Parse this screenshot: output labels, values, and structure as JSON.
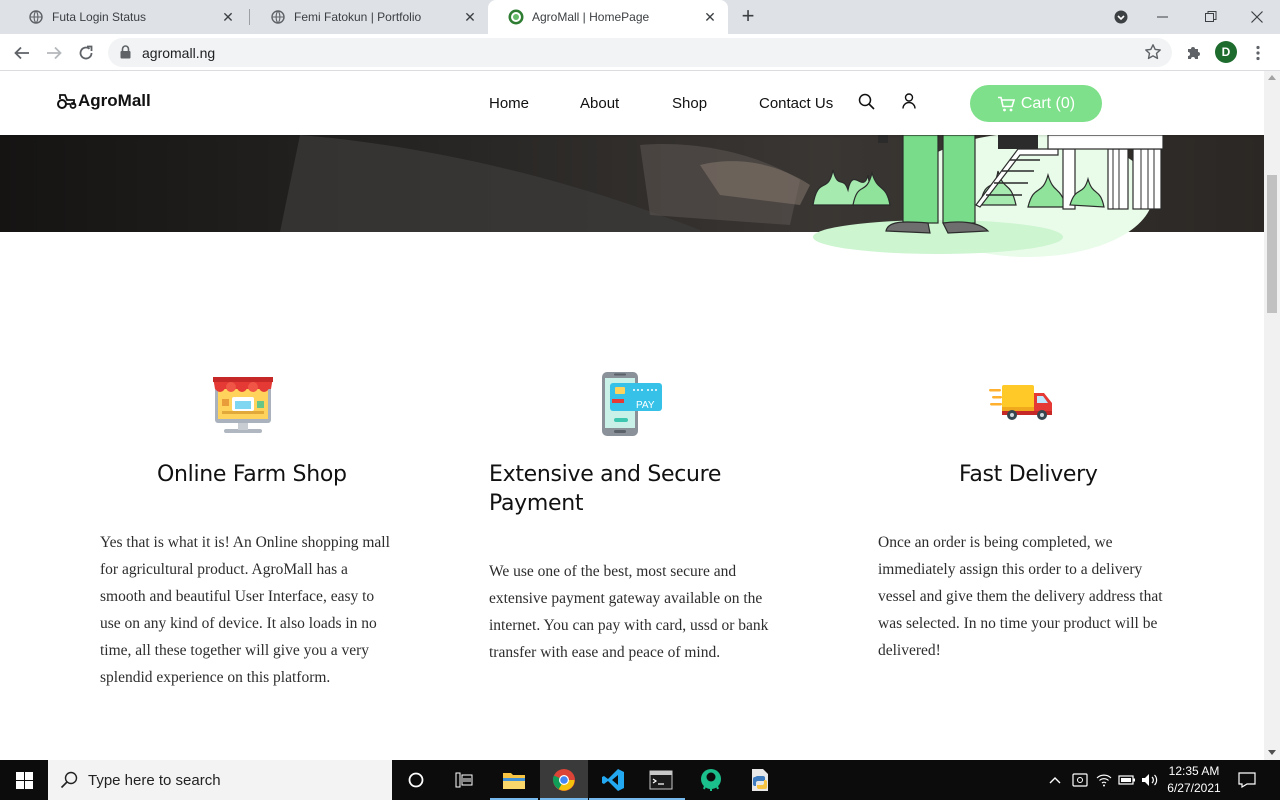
{
  "browser": {
    "tabs": [
      {
        "title": "Futa Login Status",
        "active": false
      },
      {
        "title": "Femi Fatokun | Portfolio",
        "active": false
      },
      {
        "title": "AgroMall | HomePage",
        "active": true
      }
    ],
    "url": "agromall.ng",
    "profile_initial": "D"
  },
  "site": {
    "logo": "AgroMall",
    "nav": [
      "Home",
      "About",
      "Shop",
      "Contact Us"
    ],
    "cart_label": "Cart (0)",
    "accent_color": "#7ee08a"
  },
  "features": [
    {
      "icon": "shop-stall-icon",
      "title": "Online Farm Shop",
      "text": "Yes that is what it is! An Online shopping mall for agricultural product. AgroMall has a smooth and beautiful User Interface, easy to use on any kind of device. It also loads in no time, all these together will give you a very splendid experience on this platform."
    },
    {
      "icon": "mobile-pay-icon",
      "title": "Extensive and Secure Payment",
      "icon_label": "PAY",
      "text": "We use one of the best, most secure and extensive payment gateway available on the internet. You can pay with card, ussd or bank transfer with ease and peace of mind."
    },
    {
      "icon": "delivery-truck-icon",
      "title": "Fast Delivery",
      "text": "Once an order is being completed, we immediately assign this order to a delivery vessel and give them the delivery address that was selected. In no time your product will be delivered!"
    }
  ],
  "taskbar": {
    "search_placeholder": "Type here to search",
    "time": "12:35 AM",
    "date": "6/27/2021"
  }
}
